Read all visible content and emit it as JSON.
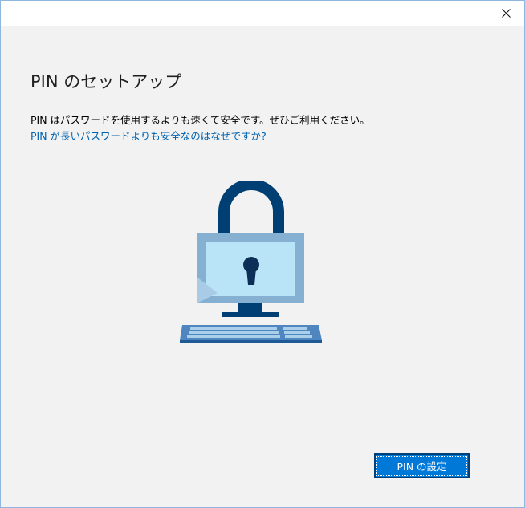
{
  "window": {
    "close_icon": "close-icon"
  },
  "header": {
    "title": "PIN のセットアップ"
  },
  "body": {
    "description": "PIN はパスワードを使用するよりも速くて安全です。ぜひご利用ください。",
    "link_text": "PIN が長いパスワードよりも安全なのはなぜですか?"
  },
  "illustration": {
    "icon": "locked-computer-icon"
  },
  "footer": {
    "set_pin_label": "PIN の設定"
  },
  "colors": {
    "background": "#f2f2f2",
    "link": "#0063b1",
    "button": "#0078d7",
    "lock_dark": "#003f73",
    "monitor_frame": "#86b0d2",
    "screen": "#b9e3f6"
  }
}
